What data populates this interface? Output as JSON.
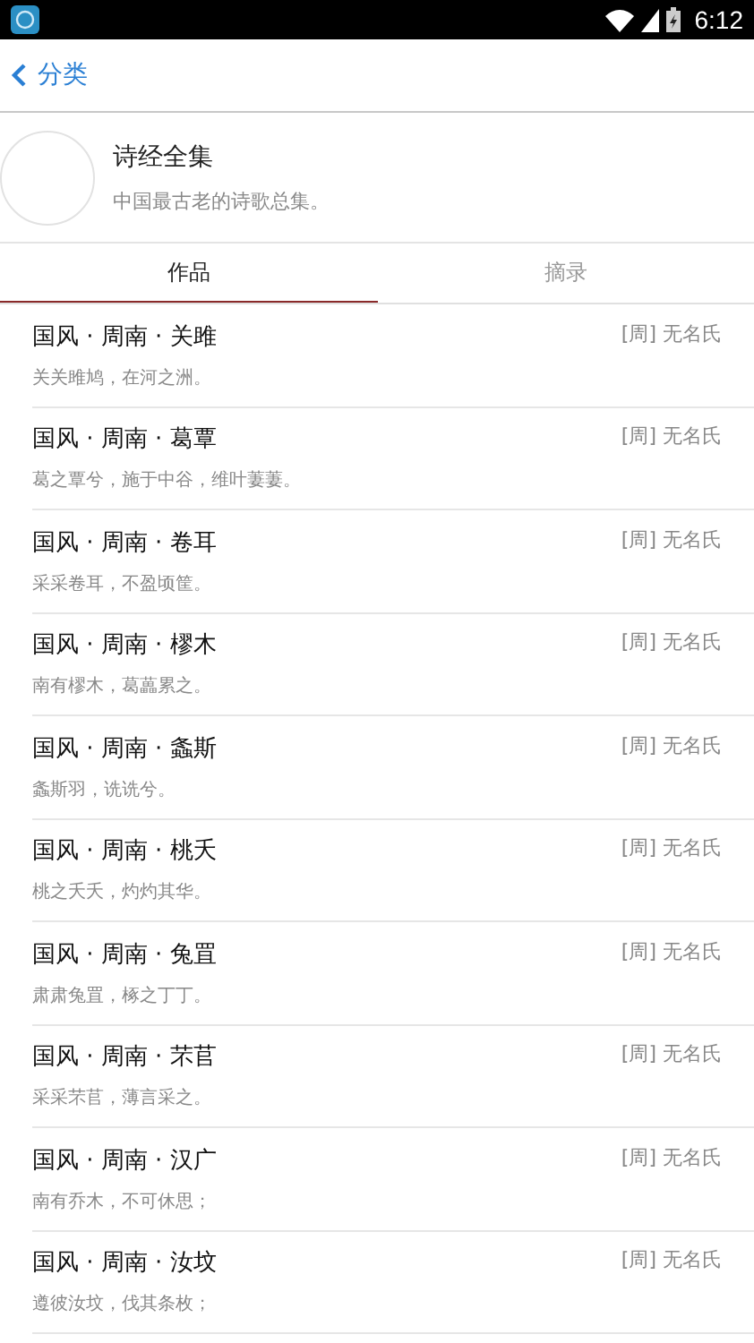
{
  "status_bar": {
    "time": "6:12"
  },
  "nav": {
    "back_label": "分类"
  },
  "collection": {
    "title": "诗经全集",
    "description": "中国最古老的诗歌总集。"
  },
  "tabs": [
    {
      "label": "作品",
      "selected": true
    },
    {
      "label": "摘录",
      "selected": false
    }
  ],
  "poems": [
    {
      "title": "国风 · 周南 · 关雎",
      "author": "[周] 无名氏",
      "excerpt": "关关雎鸠，在河之洲。"
    },
    {
      "title": "国风 · 周南 · 葛覃",
      "author": "[周] 无名氏",
      "excerpt": "葛之覃兮，施于中谷，维叶萋萋。"
    },
    {
      "title": "国风 · 周南 · 卷耳",
      "author": "[周] 无名氏",
      "excerpt": "采采卷耳，不盈顷筐。"
    },
    {
      "title": "国风 · 周南 · 樛木",
      "author": "[周] 无名氏",
      "excerpt": "南有樛木，葛藟累之。"
    },
    {
      "title": "国风 · 周南 · 螽斯",
      "author": "[周] 无名氏",
      "excerpt": "螽斯羽，诜诜兮。"
    },
    {
      "title": "国风 · 周南 · 桃夭",
      "author": "[周] 无名氏",
      "excerpt": "桃之夭夭，灼灼其华。"
    },
    {
      "title": "国风 · 周南 · 兔罝",
      "author": "[周] 无名氏",
      "excerpt": "肃肃兔罝，椓之丁丁。"
    },
    {
      "title": "国风 · 周南 · 芣苢",
      "author": "[周] 无名氏",
      "excerpt": "采采芣苢，薄言采之。"
    },
    {
      "title": "国风 · 周南 · 汉广",
      "author": "[周] 无名氏",
      "excerpt": "南有乔木，不可休思；"
    },
    {
      "title": "国风 · 周南 · 汝坟",
      "author": "[周] 无名氏",
      "excerpt": "遵彼汝坟，伐其条枚；"
    }
  ]
}
